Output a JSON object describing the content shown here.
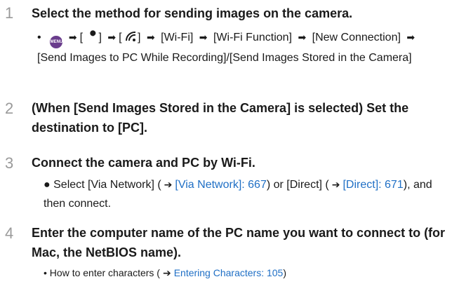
{
  "steps": [
    {
      "num": "1",
      "title": "Select the method for sending images on the camera.",
      "path": {
        "icons": [
          "menu-icon",
          "wrench-icon",
          "wifi-icon"
        ],
        "seg1": "[Wi-Fi]",
        "seg2": "[Wi-Fi Function]",
        "seg3": "[New Connection]",
        "seg4": "[Send Images to PC While Recording]/[Send Images Stored in the Camera]"
      }
    },
    {
      "num": "2",
      "title": "(When [Send Images Stored in the Camera] is selected) Set the destination to [PC]."
    },
    {
      "num": "3",
      "title": "Connect the camera and PC by Wi-Fi.",
      "note": {
        "pre": "Select [Via Network] (",
        "link1": "[Via Network]: 667",
        "mid": ") or [Direct] (",
        "link2": "[Direct]: 671",
        "post": "), and then connect."
      }
    },
    {
      "num": "4",
      "title": "Enter the computer name of the PC name you want to connect to (for Mac, the NetBIOS name).",
      "note": {
        "pre": "How to enter characters (",
        "link": "Entering Characters: 105",
        "post": ")"
      }
    }
  ],
  "colors": {
    "link": "#1f6fc5",
    "step_number": "#9a9a9a",
    "menu_icon": "#6a3d8c"
  }
}
